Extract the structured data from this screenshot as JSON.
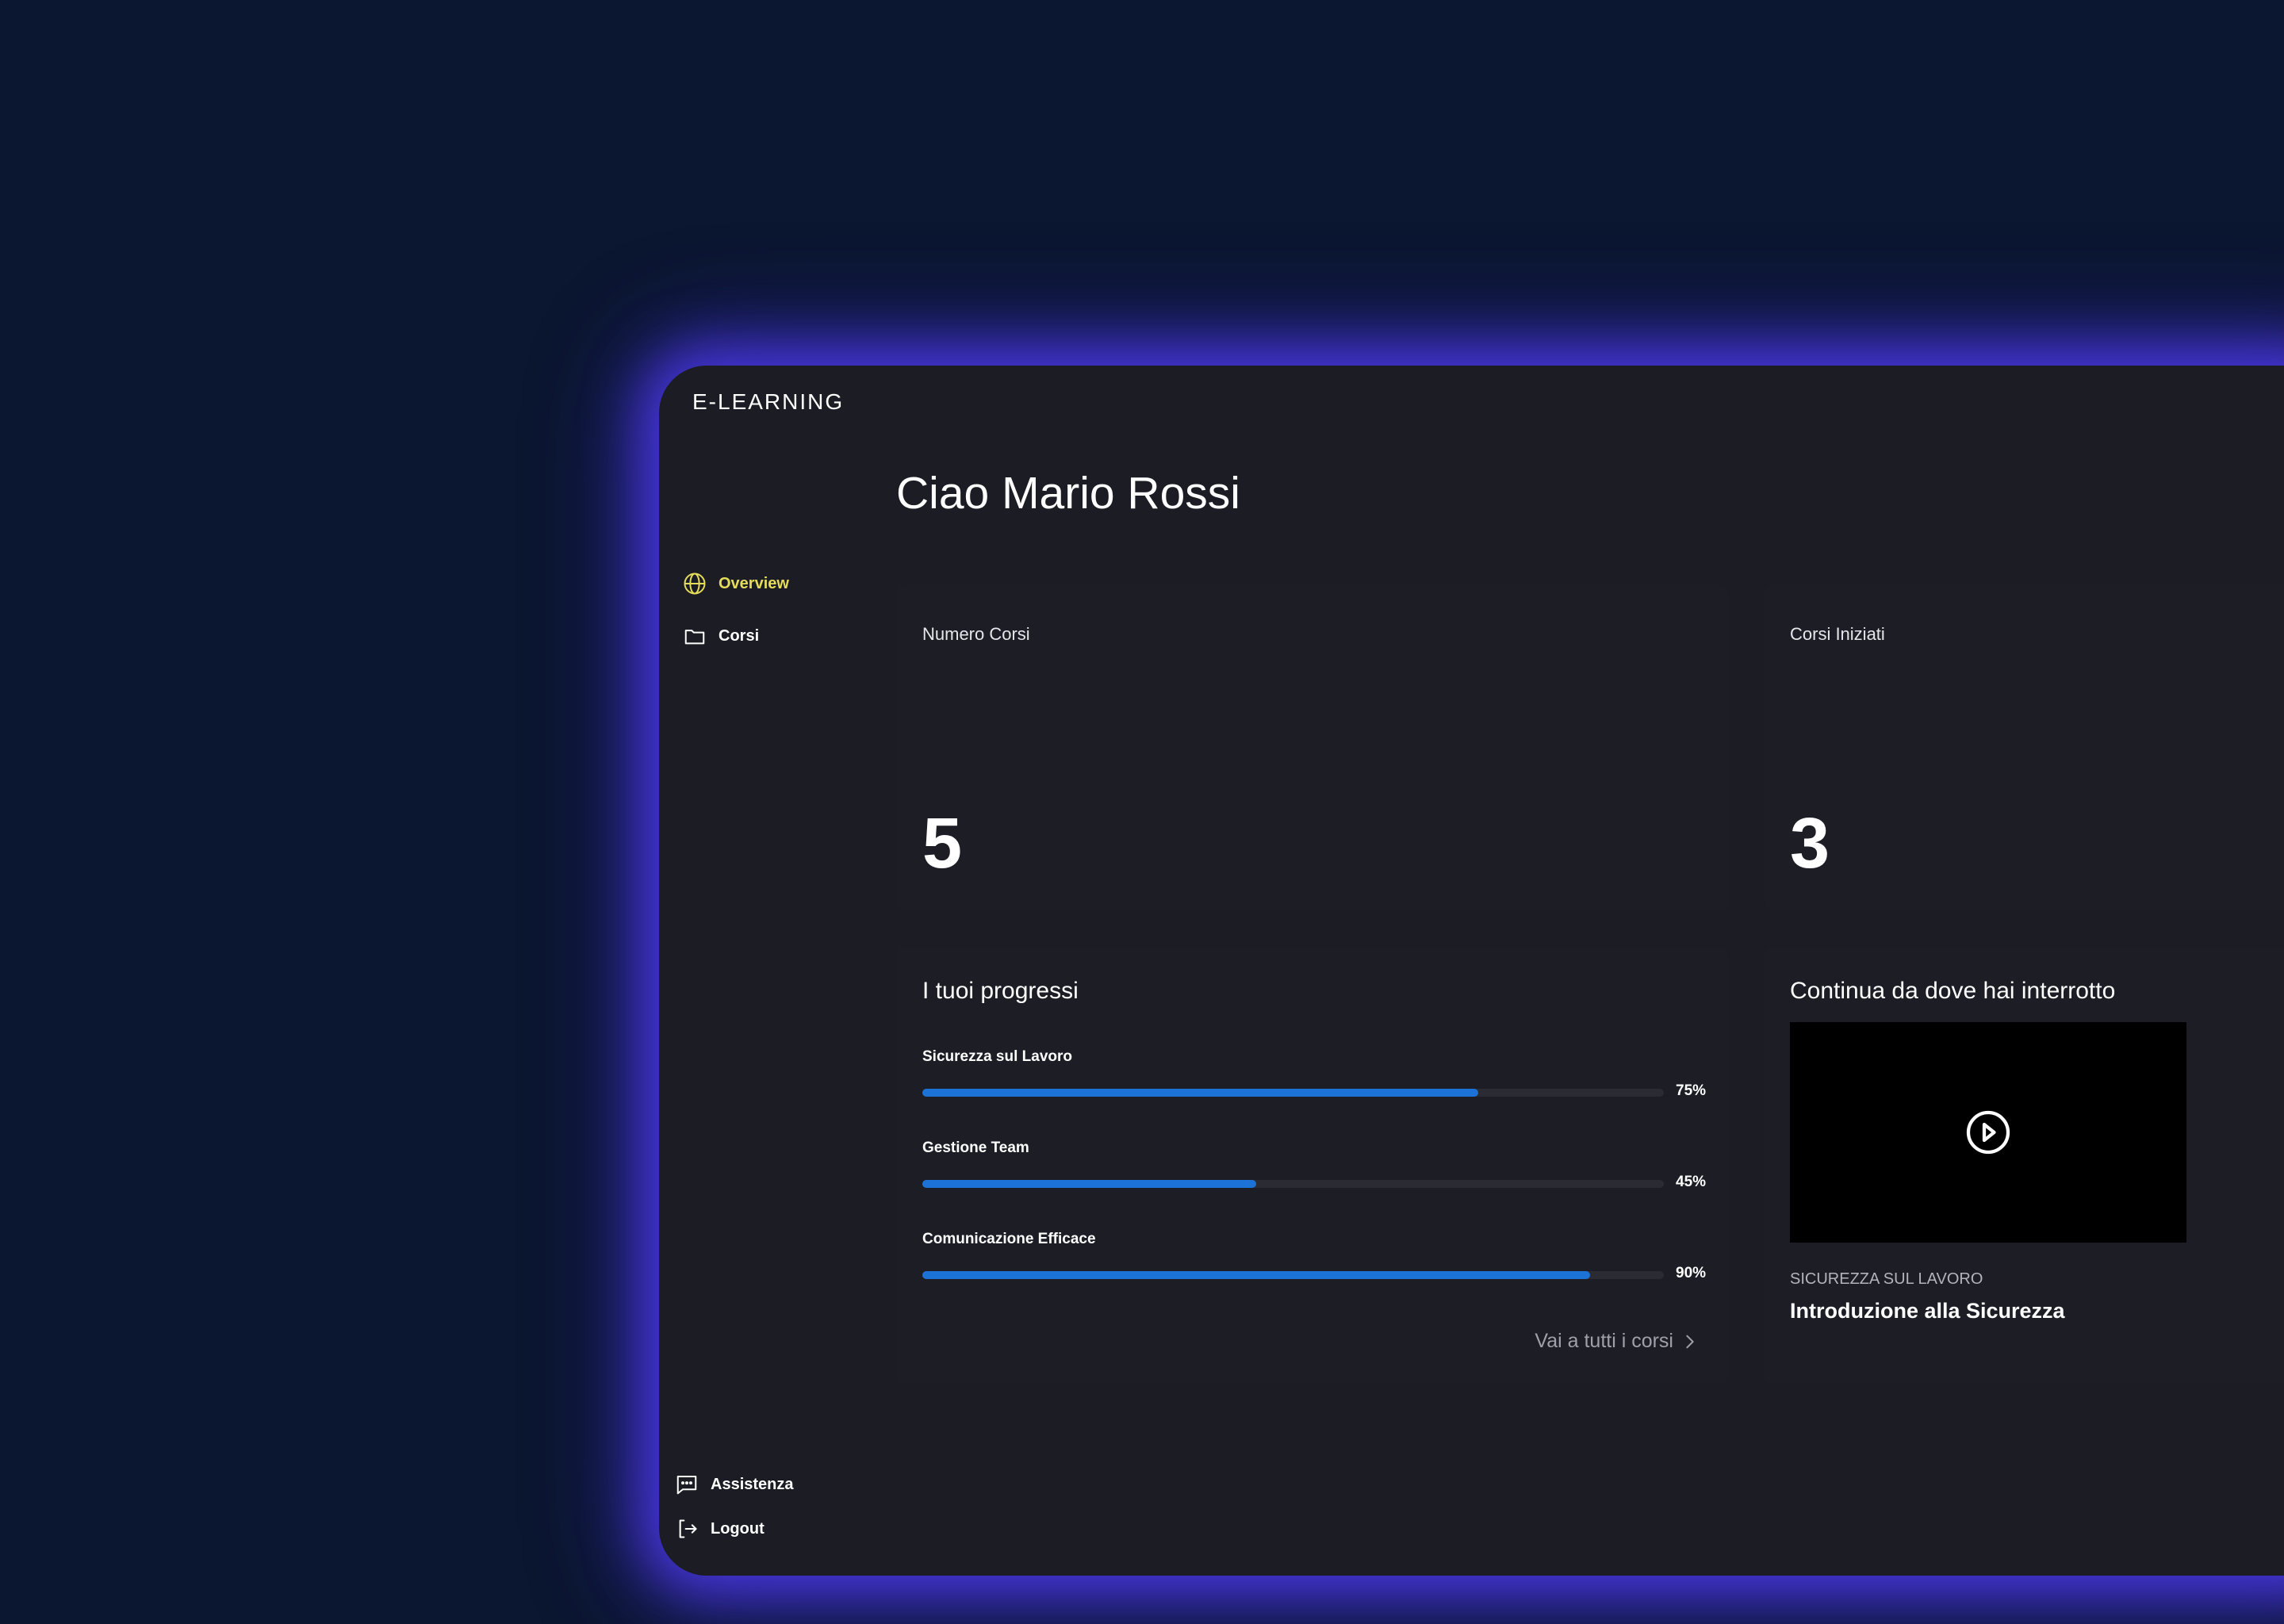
{
  "brand": "E-LEARNING",
  "sidebar": {
    "items": [
      {
        "label": "Overview",
        "icon": "globe-icon",
        "active": true
      },
      {
        "label": "Corsi",
        "icon": "folder-icon",
        "active": false
      }
    ],
    "footer": [
      {
        "label": "Assistenza",
        "icon": "chat-icon"
      },
      {
        "label": "Logout",
        "icon": "logout-icon"
      }
    ]
  },
  "greeting": "Ciao Mario Rossi",
  "stats": [
    {
      "label": "Numero Corsi",
      "value": "5"
    },
    {
      "label": "Corsi Iniziati",
      "value": "3"
    }
  ],
  "progress": {
    "title": "I tuoi progressi",
    "items": [
      {
        "name": "Sicurezza sul Lavoro",
        "percent": 75,
        "label": "75%"
      },
      {
        "name": "Gestione Team",
        "percent": 45,
        "label": "45%"
      },
      {
        "name": "Comunicazione Efficace",
        "percent": 90,
        "label": "90%"
      }
    ],
    "link": "Vai a tutti i corsi"
  },
  "resume": {
    "title": "Continua da dove hai interrotto",
    "category": "SICUREZZA SUL LAVORO",
    "course_title": "Introduzione alla Sicurezza"
  },
  "colors": {
    "background": "#0b1630",
    "panel": "#1c1c24",
    "card": "#1d1d26",
    "accent_active": "#e4dc5a",
    "progress_fill": "#1c72d6",
    "glow": "#4c3aeb"
  }
}
